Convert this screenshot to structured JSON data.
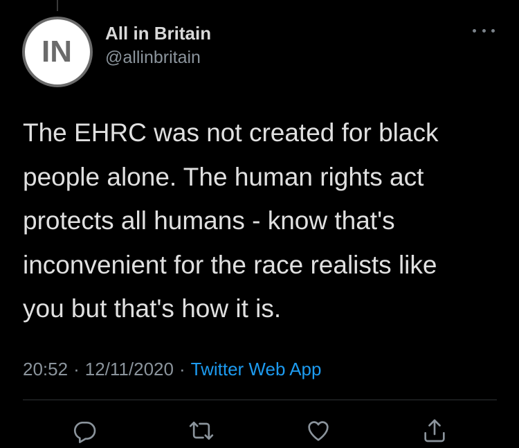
{
  "author": {
    "avatar_text": "IN",
    "display_name": "All in Britain",
    "handle": "@allinbritain"
  },
  "tweet": {
    "text": "The EHRC was not created for black\npeople alone. The human rights act\nprotects all humans - know that's\ninconvenient for the race realists like\nyou but that's how it is.",
    "time": "20:52",
    "date": "12/11/2020",
    "separator": "·",
    "source": "Twitter Web App"
  },
  "actions": {
    "icons": [
      "reply-icon",
      "retweet-icon",
      "like-icon",
      "share-icon"
    ]
  },
  "colors": {
    "background": "#000000",
    "text": "#e0e0e0",
    "secondary": "#8b949c",
    "link": "#1d9bf0"
  }
}
